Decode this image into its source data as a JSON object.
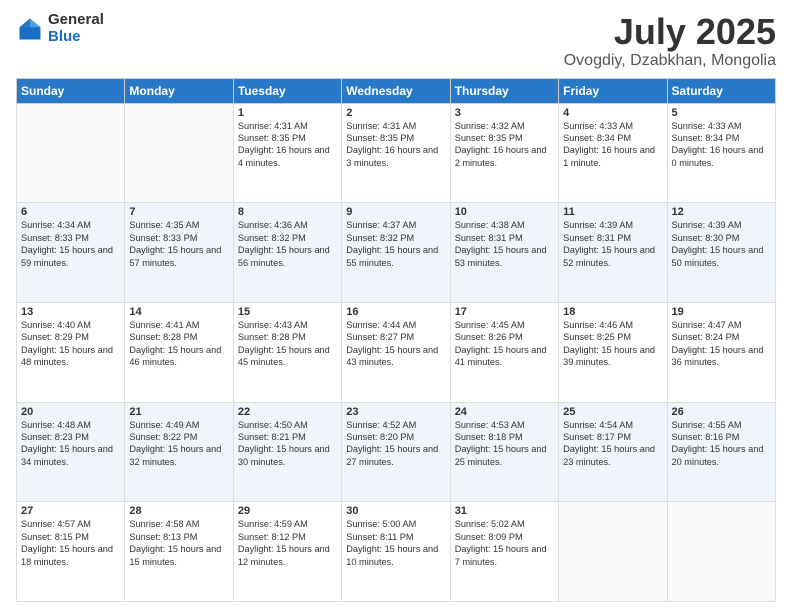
{
  "header": {
    "logo": {
      "general": "General",
      "blue": "Blue"
    },
    "title": "July 2025",
    "location": "Ovogdiy, Dzabkhan, Mongolia"
  },
  "weekdays": [
    "Sunday",
    "Monday",
    "Tuesday",
    "Wednesday",
    "Thursday",
    "Friday",
    "Saturday"
  ],
  "weeks": [
    [
      {
        "day": "",
        "info": ""
      },
      {
        "day": "",
        "info": ""
      },
      {
        "day": "1",
        "info": "Sunrise: 4:31 AM\nSunset: 8:35 PM\nDaylight: 16 hours\nand 4 minutes."
      },
      {
        "day": "2",
        "info": "Sunrise: 4:31 AM\nSunset: 8:35 PM\nDaylight: 16 hours\nand 3 minutes."
      },
      {
        "day": "3",
        "info": "Sunrise: 4:32 AM\nSunset: 8:35 PM\nDaylight: 16 hours\nand 2 minutes."
      },
      {
        "day": "4",
        "info": "Sunrise: 4:33 AM\nSunset: 8:34 PM\nDaylight: 16 hours\nand 1 minute."
      },
      {
        "day": "5",
        "info": "Sunrise: 4:33 AM\nSunset: 8:34 PM\nDaylight: 16 hours\nand 0 minutes."
      }
    ],
    [
      {
        "day": "6",
        "info": "Sunrise: 4:34 AM\nSunset: 8:33 PM\nDaylight: 15 hours\nand 59 minutes."
      },
      {
        "day": "7",
        "info": "Sunrise: 4:35 AM\nSunset: 8:33 PM\nDaylight: 15 hours\nand 57 minutes."
      },
      {
        "day": "8",
        "info": "Sunrise: 4:36 AM\nSunset: 8:32 PM\nDaylight: 15 hours\nand 56 minutes."
      },
      {
        "day": "9",
        "info": "Sunrise: 4:37 AM\nSunset: 8:32 PM\nDaylight: 15 hours\nand 55 minutes."
      },
      {
        "day": "10",
        "info": "Sunrise: 4:38 AM\nSunset: 8:31 PM\nDaylight: 15 hours\nand 53 minutes."
      },
      {
        "day": "11",
        "info": "Sunrise: 4:39 AM\nSunset: 8:31 PM\nDaylight: 15 hours\nand 52 minutes."
      },
      {
        "day": "12",
        "info": "Sunrise: 4:39 AM\nSunset: 8:30 PM\nDaylight: 15 hours\nand 50 minutes."
      }
    ],
    [
      {
        "day": "13",
        "info": "Sunrise: 4:40 AM\nSunset: 8:29 PM\nDaylight: 15 hours\nand 48 minutes."
      },
      {
        "day": "14",
        "info": "Sunrise: 4:41 AM\nSunset: 8:28 PM\nDaylight: 15 hours\nand 46 minutes."
      },
      {
        "day": "15",
        "info": "Sunrise: 4:43 AM\nSunset: 8:28 PM\nDaylight: 15 hours\nand 45 minutes."
      },
      {
        "day": "16",
        "info": "Sunrise: 4:44 AM\nSunset: 8:27 PM\nDaylight: 15 hours\nand 43 minutes."
      },
      {
        "day": "17",
        "info": "Sunrise: 4:45 AM\nSunset: 8:26 PM\nDaylight: 15 hours\nand 41 minutes."
      },
      {
        "day": "18",
        "info": "Sunrise: 4:46 AM\nSunset: 8:25 PM\nDaylight: 15 hours\nand 39 minutes."
      },
      {
        "day": "19",
        "info": "Sunrise: 4:47 AM\nSunset: 8:24 PM\nDaylight: 15 hours\nand 36 minutes."
      }
    ],
    [
      {
        "day": "20",
        "info": "Sunrise: 4:48 AM\nSunset: 8:23 PM\nDaylight: 15 hours\nand 34 minutes."
      },
      {
        "day": "21",
        "info": "Sunrise: 4:49 AM\nSunset: 8:22 PM\nDaylight: 15 hours\nand 32 minutes."
      },
      {
        "day": "22",
        "info": "Sunrise: 4:50 AM\nSunset: 8:21 PM\nDaylight: 15 hours\nand 30 minutes."
      },
      {
        "day": "23",
        "info": "Sunrise: 4:52 AM\nSunset: 8:20 PM\nDaylight: 15 hours\nand 27 minutes."
      },
      {
        "day": "24",
        "info": "Sunrise: 4:53 AM\nSunset: 8:18 PM\nDaylight: 15 hours\nand 25 minutes."
      },
      {
        "day": "25",
        "info": "Sunrise: 4:54 AM\nSunset: 8:17 PM\nDaylight: 15 hours\nand 23 minutes."
      },
      {
        "day": "26",
        "info": "Sunrise: 4:55 AM\nSunset: 8:16 PM\nDaylight: 15 hours\nand 20 minutes."
      }
    ],
    [
      {
        "day": "27",
        "info": "Sunrise: 4:57 AM\nSunset: 8:15 PM\nDaylight: 15 hours\nand 18 minutes."
      },
      {
        "day": "28",
        "info": "Sunrise: 4:58 AM\nSunset: 8:13 PM\nDaylight: 15 hours\nand 15 minutes."
      },
      {
        "day": "29",
        "info": "Sunrise: 4:59 AM\nSunset: 8:12 PM\nDaylight: 15 hours\nand 12 minutes."
      },
      {
        "day": "30",
        "info": "Sunrise: 5:00 AM\nSunset: 8:11 PM\nDaylight: 15 hours\nand 10 minutes."
      },
      {
        "day": "31",
        "info": "Sunrise: 5:02 AM\nSunset: 8:09 PM\nDaylight: 15 hours\nand 7 minutes."
      },
      {
        "day": "",
        "info": ""
      },
      {
        "day": "",
        "info": ""
      }
    ]
  ]
}
